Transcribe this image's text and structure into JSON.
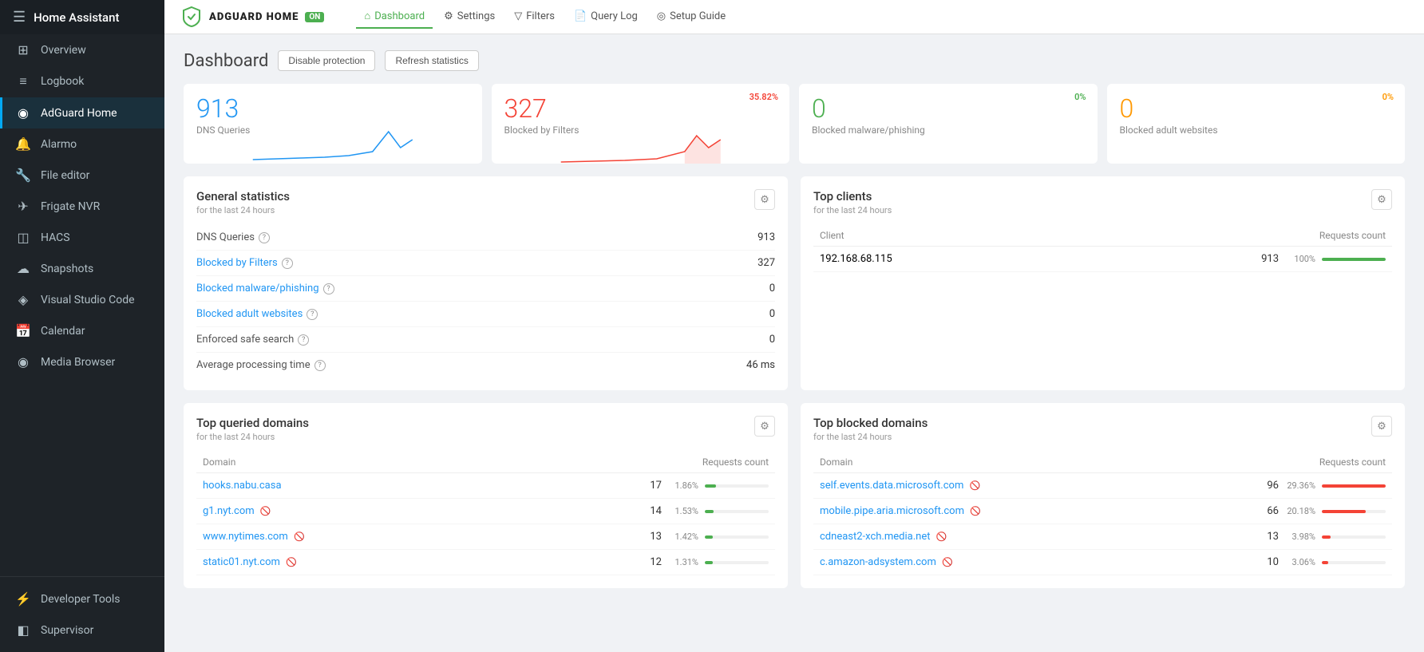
{
  "app": {
    "title": "Home Assistant"
  },
  "sidebar": {
    "items": [
      {
        "id": "overview",
        "label": "Overview",
        "icon": "⊞",
        "active": false
      },
      {
        "id": "logbook",
        "label": "Logbook",
        "icon": "≡",
        "active": false
      },
      {
        "id": "adguard",
        "label": "AdGuard Home",
        "icon": "◉",
        "active": true
      },
      {
        "id": "alarmo",
        "label": "Alarmo",
        "icon": "🔔",
        "active": false
      },
      {
        "id": "file-editor",
        "label": "File editor",
        "icon": "🔧",
        "active": false
      },
      {
        "id": "frigate",
        "label": "Frigate NVR",
        "icon": "✈",
        "active": false
      },
      {
        "id": "hacs",
        "label": "HACS",
        "icon": "◫",
        "active": false
      },
      {
        "id": "snapshots",
        "label": "Snapshots",
        "icon": "☁",
        "active": false
      },
      {
        "id": "vscode",
        "label": "Visual Studio Code",
        "icon": "◈",
        "active": false
      },
      {
        "id": "calendar",
        "label": "Calendar",
        "icon": "📅",
        "active": false
      },
      {
        "id": "media",
        "label": "Media Browser",
        "icon": "◉",
        "active": false
      }
    ],
    "bottom": [
      {
        "id": "dev-tools",
        "label": "Developer Tools",
        "icon": "⚡",
        "active": false
      },
      {
        "id": "supervisor",
        "label": "Supervisor",
        "icon": "◧",
        "active": false
      }
    ]
  },
  "topnav": {
    "brand": "ADGUARD HOME",
    "status": "ON",
    "links": [
      {
        "id": "dashboard",
        "label": "Dashboard",
        "icon": "⊞",
        "active": true
      },
      {
        "id": "settings",
        "label": "Settings",
        "icon": "⚙",
        "active": false
      },
      {
        "id": "filters",
        "label": "Filters",
        "icon": "▽",
        "active": false
      },
      {
        "id": "query-log",
        "label": "Query Log",
        "icon": "📄",
        "active": false
      },
      {
        "id": "setup-guide",
        "label": "Setup Guide",
        "icon": "◎",
        "active": false
      }
    ]
  },
  "dashboard": {
    "title": "Dashboard",
    "btn_disable": "Disable protection",
    "btn_refresh": "Refresh statistics",
    "stat_cards": [
      {
        "id": "dns-queries",
        "value": "913",
        "label": "DNS Queries",
        "color": "blue",
        "percent": null,
        "chart_type": "blue"
      },
      {
        "id": "blocked-filters",
        "value": "327",
        "label": "Blocked by Filters",
        "color": "red",
        "percent": "35.82%",
        "chart_type": "red"
      },
      {
        "id": "blocked-malware",
        "value": "0",
        "label": "Blocked malware/phishing",
        "color": "green",
        "percent": "0%",
        "chart_type": "none"
      },
      {
        "id": "blocked-adult",
        "value": "0",
        "label": "Blocked adult websites",
        "color": "yellow",
        "percent": "0%",
        "chart_type": "none"
      }
    ],
    "general_stats": {
      "title": "General statistics",
      "subtitle": "for the last 24 hours",
      "rows": [
        {
          "label": "DNS Queries",
          "value": "913",
          "link": false,
          "has_help": true
        },
        {
          "label": "Blocked by Filters",
          "value": "327",
          "link": true,
          "has_help": true
        },
        {
          "label": "Blocked malware/phishing",
          "value": "0",
          "link": true,
          "has_help": true
        },
        {
          "label": "Blocked adult websites",
          "value": "0",
          "link": true,
          "has_help": true
        },
        {
          "label": "Enforced safe search",
          "value": "0",
          "link": false,
          "has_help": true
        },
        {
          "label": "Average processing time",
          "value": "46 ms",
          "link": false,
          "has_help": true
        }
      ]
    },
    "top_clients": {
      "title": "Top clients",
      "subtitle": "for the last 24 hours",
      "columns": [
        "Client",
        "Requests count"
      ],
      "rows": [
        {
          "client": "192.168.68.115",
          "count": "913",
          "percent": "100%",
          "bar_pct": 100,
          "bar_color": "green"
        }
      ]
    },
    "top_queried": {
      "title": "Top queried domains",
      "subtitle": "for the last 24 hours",
      "columns": [
        "Domain",
        "Requests count"
      ],
      "rows": [
        {
          "domain": "hooks.nabu.casa",
          "count": 17,
          "percent": "1.86%",
          "bar_pct": 18,
          "has_icon": false
        },
        {
          "domain": "g1.nyt.com",
          "count": 14,
          "percent": "1.53%",
          "bar_pct": 14,
          "has_icon": true
        },
        {
          "domain": "www.nytimes.com",
          "count": 13,
          "percent": "1.42%",
          "bar_pct": 13,
          "has_icon": true
        },
        {
          "domain": "static01.nyt.com",
          "count": 12,
          "percent": "1.31%",
          "bar_pct": 12,
          "has_icon": true
        }
      ]
    },
    "top_blocked": {
      "title": "Top blocked domains",
      "subtitle": "for the last 24 hours",
      "columns": [
        "Domain",
        "Requests count"
      ],
      "rows": [
        {
          "domain": "self.events.data.microsoft.com",
          "count": 96,
          "percent": "29.36%",
          "bar_pct": 100,
          "has_icon": true
        },
        {
          "domain": "mobile.pipe.aria.microsoft.com",
          "count": 66,
          "percent": "20.18%",
          "bar_pct": 69,
          "has_icon": true
        },
        {
          "domain": "cdneast2-xch.media.net",
          "count": 13,
          "percent": "3.98%",
          "bar_pct": 14,
          "has_icon": true
        },
        {
          "domain": "c.amazon-adsystem.com",
          "count": 10,
          "percent": "3.06%",
          "bar_pct": 10,
          "has_icon": true
        }
      ]
    }
  }
}
